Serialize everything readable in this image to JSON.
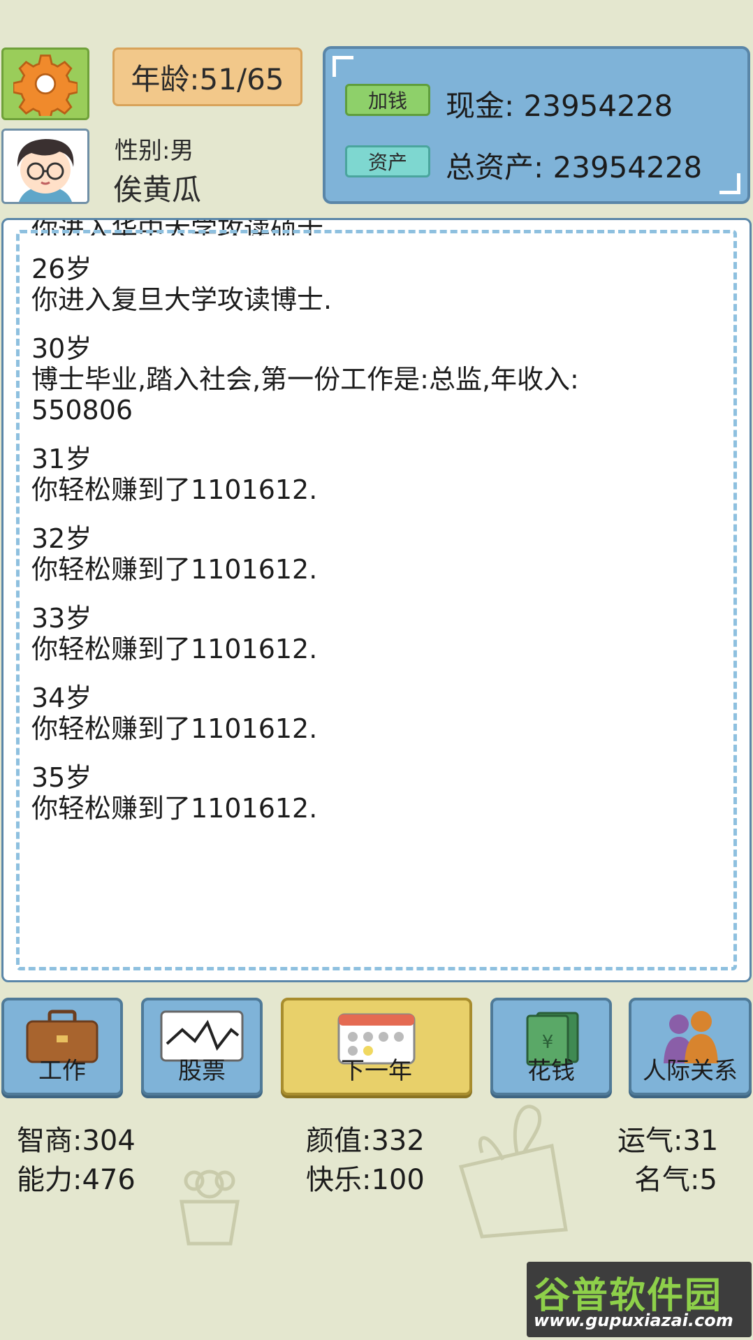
{
  "header": {
    "age": "年龄:51/65",
    "gender": "性别:男",
    "name": "俟黄瓜"
  },
  "money": {
    "add_money_button": "加钱",
    "assets_button": "资产",
    "cash": "现金: 23954228",
    "total_assets": "总资产: 23954228"
  },
  "log": {
    "partial_top": "你进入华中大学攻读硕士.",
    "entries": [
      {
        "age": "26岁",
        "text": "你进入复旦大学攻读博士."
      },
      {
        "age": "30岁",
        "text": "博士毕业,踏入社会,第一份工作是:总监,年收入:",
        "text2": "550806"
      },
      {
        "age": "31岁",
        "text": "你轻松赚到了1101612."
      },
      {
        "age": "32岁",
        "text": "你轻松赚到了1101612."
      },
      {
        "age": "33岁",
        "text": "你轻松赚到了1101612."
      },
      {
        "age": "34岁",
        "text": "你轻松赚到了1101612."
      },
      {
        "age": "35岁",
        "text": "你轻松赚到了1101612."
      }
    ]
  },
  "actions": {
    "work": "工作",
    "stocks": "股票",
    "next_year": "下一年",
    "spend": "花钱",
    "relations": "人际关系"
  },
  "stats": {
    "iq": "智商:304",
    "looks": "颜值:332",
    "luck": "运气:31",
    "ability": "能力:476",
    "happiness": "快乐:100",
    "fame": "名气:5"
  },
  "watermark": {
    "title": "谷普软件园",
    "url": "www.gupuxiazai.com"
  }
}
